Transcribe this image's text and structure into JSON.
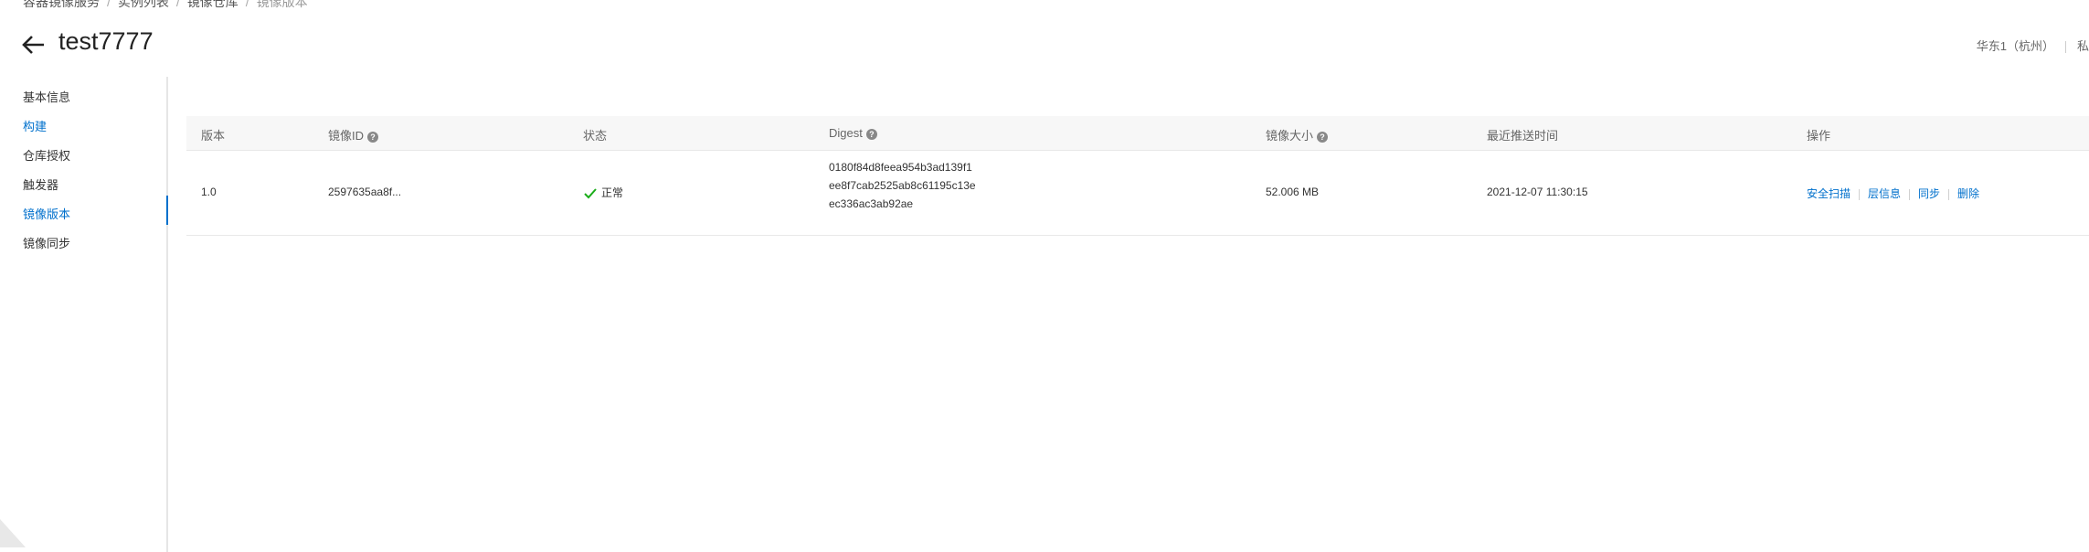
{
  "breadcrumb": [
    "容器镜像服务",
    "实例列表",
    "镜像仓库",
    "镜像版本"
  ],
  "page": {
    "title": "test7777"
  },
  "header_right": {
    "region": "华东1（杭州）",
    "extra": "私"
  },
  "sidebar": {
    "items": [
      {
        "label": "基本信息",
        "state": "normal"
      },
      {
        "label": "构建",
        "state": "link"
      },
      {
        "label": "仓库授权",
        "state": "normal"
      },
      {
        "label": "触发器",
        "state": "normal"
      },
      {
        "label": "镜像版本",
        "state": "active"
      },
      {
        "label": "镜像同步",
        "state": "normal"
      }
    ]
  },
  "table": {
    "columns": [
      "版本",
      "镜像ID",
      "状态",
      "Digest",
      "镜像大小",
      "最近推送时间",
      "操作"
    ],
    "rows": [
      {
        "version": "1.0",
        "image_id": "2597635aa8f...",
        "status": "正常",
        "digest": [
          "0180f84d8feea954b3ad139f1",
          "ee8f7cab2525ab8c61195c13e",
          "ec336ac3ab92ae"
        ],
        "size": "52.006 MB",
        "pushed_at": "2021-12-07 11:30:15",
        "actions": [
          "安全扫描",
          "层信息",
          "同步",
          "删除"
        ]
      }
    ]
  },
  "colors": {
    "accent": "#0070cc",
    "success": "#1aad19",
    "header_bg": "#f7f7f7"
  },
  "icons": {
    "back": "arrow-left-icon",
    "help": "question-circle-icon",
    "status": "check-icon"
  }
}
